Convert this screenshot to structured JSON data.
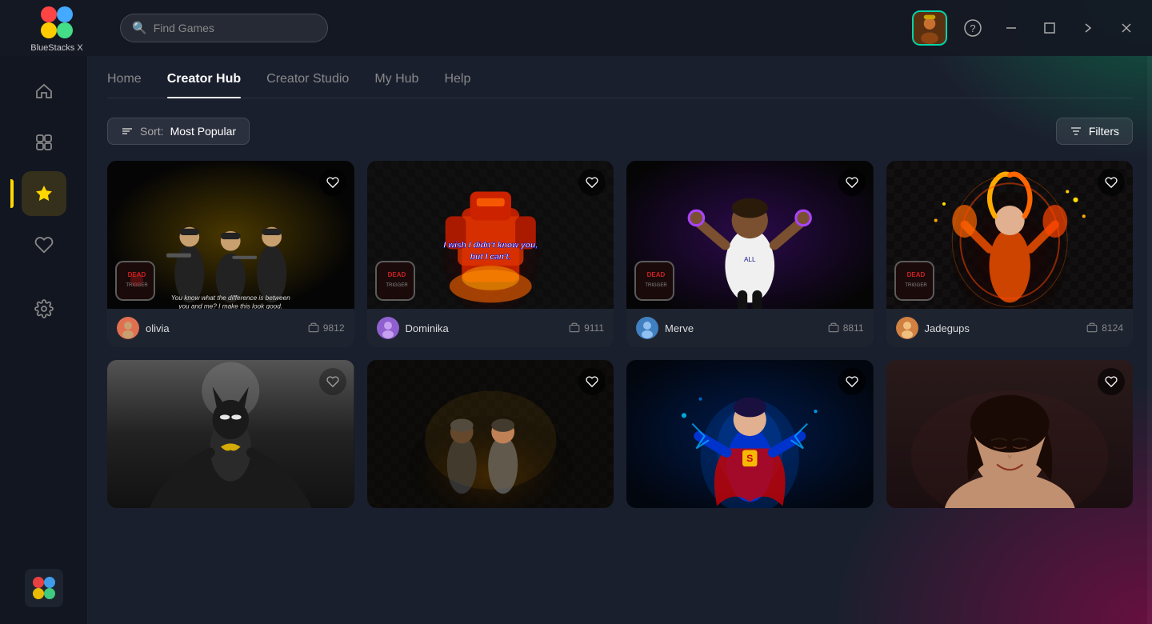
{
  "app": {
    "title": "BlueStacks X",
    "logo_label": "BlueStacks X"
  },
  "topbar": {
    "search_placeholder": "Find Games",
    "help_icon": "?",
    "minimize_icon": "−",
    "maximize_icon": "□",
    "next_icon": "→",
    "close_icon": "×"
  },
  "sidebar": {
    "items": [
      {
        "id": "home",
        "label": "Home",
        "icon": "home"
      },
      {
        "id": "library",
        "label": "Library",
        "icon": "library"
      },
      {
        "id": "creator",
        "label": "Creator",
        "icon": "star",
        "active": true
      },
      {
        "id": "favorites",
        "label": "Favorites",
        "icon": "heart"
      },
      {
        "id": "settings",
        "label": "Settings",
        "icon": "gear"
      }
    ]
  },
  "nav": {
    "tabs": [
      {
        "id": "home",
        "label": "Home",
        "active": false
      },
      {
        "id": "creator-hub",
        "label": "Creator Hub",
        "active": true
      },
      {
        "id": "creator-studio",
        "label": "Creator Studio",
        "active": false
      },
      {
        "id": "my-hub",
        "label": "My Hub",
        "active": false
      },
      {
        "id": "help",
        "label": "Help",
        "active": false
      }
    ]
  },
  "toolbar": {
    "sort_label": "Sort:",
    "sort_value": "Most Popular",
    "filter_label": "Filters"
  },
  "cards": [
    {
      "id": "card-1",
      "creator_name": "olivia",
      "play_count": "9812",
      "liked": false,
      "theme": "men-in-black",
      "caption": "You know what the difference is between you and me? I make this look good."
    },
    {
      "id": "card-2",
      "creator_name": "Dominika",
      "play_count": "9111",
      "liked": false,
      "theme": "red-robot",
      "caption": "I wish I didn't know you, but I can't."
    },
    {
      "id": "card-3",
      "creator_name": "Merve",
      "play_count": "8811",
      "liked": false,
      "theme": "soccer-player",
      "caption": ""
    },
    {
      "id": "card-4",
      "creator_name": "Jadegups",
      "play_count": "8124",
      "liked": false,
      "theme": "fire-woman",
      "caption": ""
    },
    {
      "id": "card-5",
      "creator_name": "",
      "play_count": "",
      "liked": false,
      "theme": "batman",
      "caption": ""
    },
    {
      "id": "card-6",
      "creator_name": "",
      "play_count": "",
      "liked": false,
      "theme": "soldiers",
      "caption": ""
    },
    {
      "id": "card-7",
      "creator_name": "",
      "play_count": "",
      "liked": false,
      "theme": "superman",
      "caption": ""
    },
    {
      "id": "card-8",
      "creator_name": "",
      "play_count": "",
      "liked": false,
      "theme": "woman-portrait",
      "caption": ""
    }
  ],
  "colors": {
    "accent_green": "#00d4aa",
    "accent_yellow": "#ffd700",
    "bg_dark": "#1a1f2e",
    "sidebar_bg": "#12161f"
  }
}
